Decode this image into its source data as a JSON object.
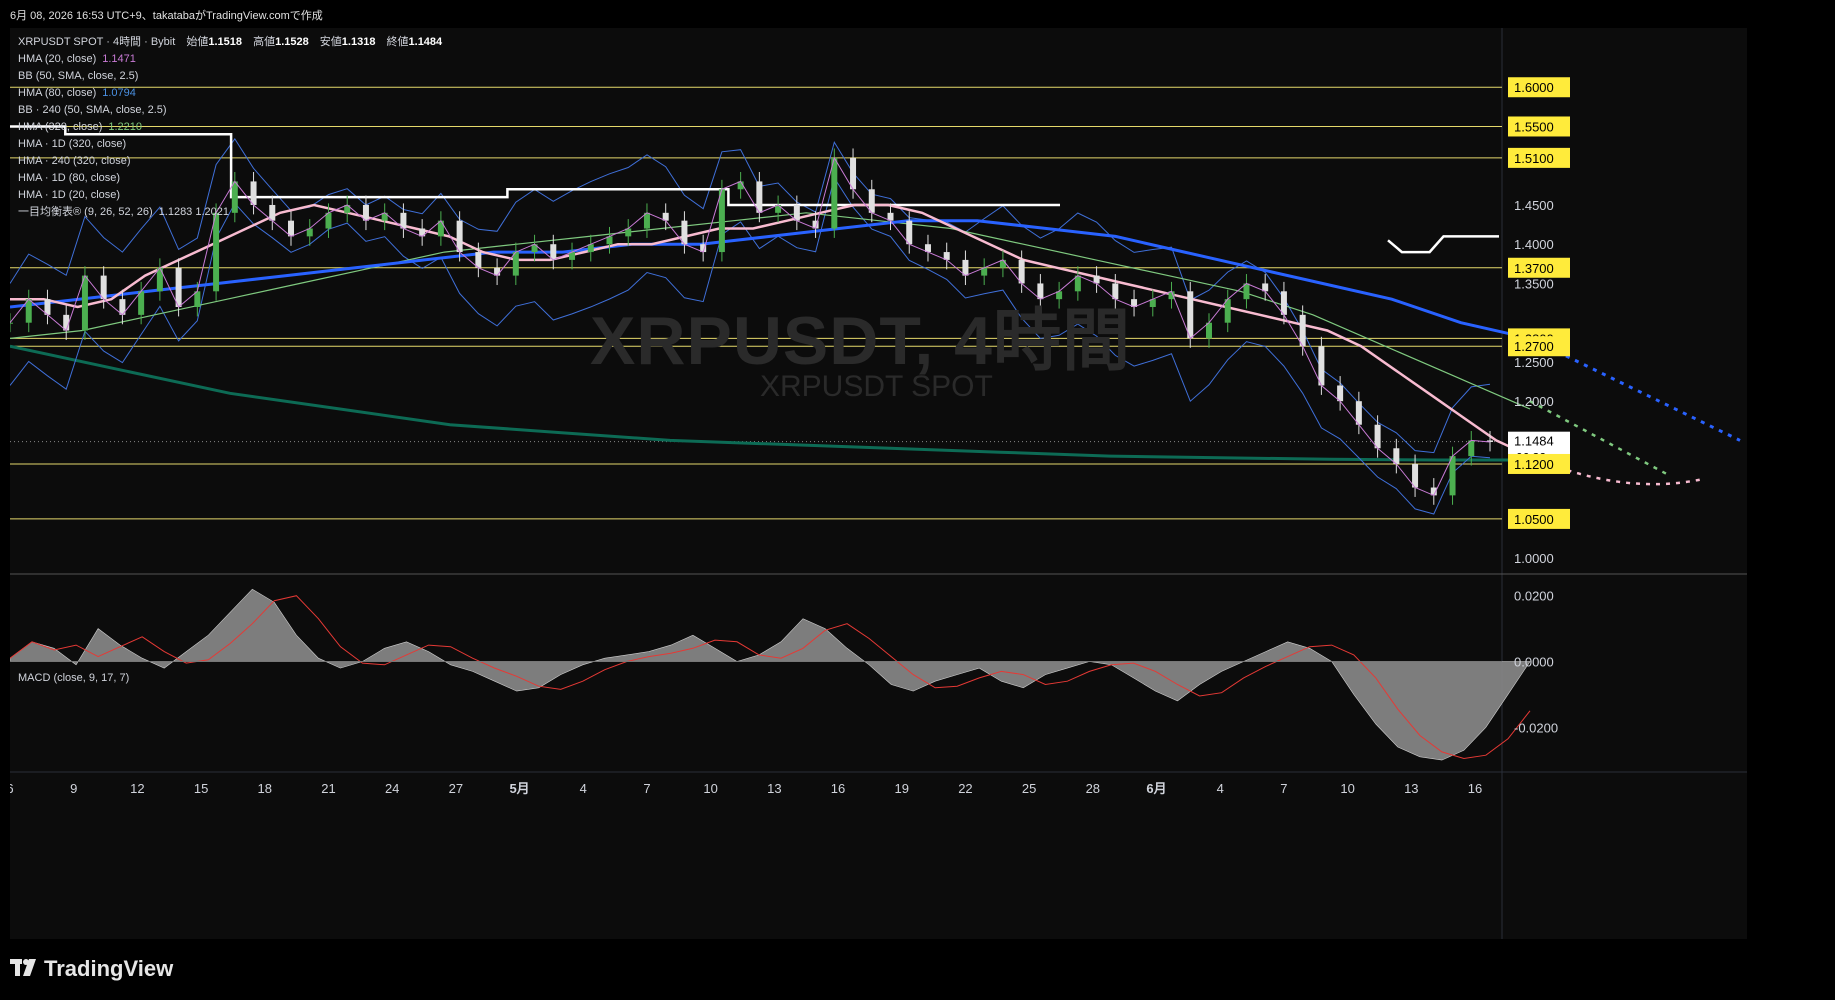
{
  "header": {
    "caption": "6月 08, 2026 16:53 UTC+9、takatabaがTradingView.comで作成"
  },
  "legend": {
    "symbol_line": "XRPUSDT SPOT · 4時間 · Bybit",
    "ohlc": [
      {
        "label": "始値",
        "value": "1.1518"
      },
      {
        "label": "高値",
        "value": "1.1528"
      },
      {
        "label": "安値",
        "value": "1.1318"
      },
      {
        "label": "終値",
        "value": "1.1484"
      }
    ],
    "indicators": [
      {
        "text": "HMA (20, close)",
        "value": "1.1471",
        "color": "#c97bd6"
      },
      {
        "text": "BB (50, SMA, close, 2.5)",
        "value": "",
        "color": "#d1d4dc"
      },
      {
        "text": "HMA (80, close)",
        "value": "1.0794",
        "color": "#4a90e2"
      },
      {
        "text": "BB · 240 (50, SMA, close, 2.5)",
        "value": "",
        "color": "#d1d4dc"
      },
      {
        "text": "HMA (320, close)",
        "value": "1.2210",
        "color": "#7fc97f"
      },
      {
        "text": "HMA · 1D (320, close)",
        "value": "",
        "color": "#d1d4dc"
      },
      {
        "text": "HMA · 240 (320, close)",
        "value": "",
        "color": "#d1d4dc"
      },
      {
        "text": "HMA · 1D (80, close)",
        "value": "",
        "color": "#d1d4dc"
      },
      {
        "text": "HMA · 1D (20, close)",
        "value": "",
        "color": "#d1d4dc"
      },
      {
        "text": "一目均衡表® (9, 26, 52, 26)",
        "value": "1.1283  1.2021",
        "color": "#d1d4dc"
      }
    ]
  },
  "watermark": {
    "main": "XRPUSDT, 4時間",
    "sub": "XRPUSDT SPOT"
  },
  "macd_label": "MACD (close, 9, 17, 7)",
  "footer": {
    "brand": "TradingView"
  },
  "colors": {
    "level_line": "#e5d96b",
    "level_badge_bg": "#ffeb3b",
    "candle_up": "#4caf50",
    "candle_down": "#e0e0e0",
    "hma20": "#c97bd6",
    "hma80": "#4a90e2",
    "hma320": "#7fc97f",
    "hma1d80": "#2962ff",
    "hma1d20": "#f8bbd0",
    "long_ma": "#0d6b55",
    "bb": "#3f6fd8",
    "step_line": "#ffffff",
    "price_badge": "#ffffff"
  },
  "chart_data": [
    {
      "type": "line",
      "title": "XRPUSDT SPOT · 4時間 · Bybit",
      "price_axis": {
        "range": [
          0.99,
          1.65
        ],
        "ticks": [
          "1.6000",
          "1.5500",
          "1.5100",
          "1.4500",
          "1.4000",
          "1.3700",
          "1.3500",
          "1.2800",
          "1.2700",
          "1.2500",
          "1.2000",
          "1.1484",
          "1.1200",
          "1.0500",
          "1.0000"
        ],
        "plain_ticks": [
          1.45,
          1.4,
          1.35,
          1.25,
          1.2,
          1.0
        ],
        "levels": [
          1.6,
          1.55,
          1.51,
          1.37,
          1.28,
          1.27,
          1.12,
          1.05
        ],
        "current_price": 1.1484,
        "countdown": "06:32"
      },
      "time_axis": {
        "labels": [
          "6",
          "9",
          "12",
          "15",
          "18",
          "21",
          "24",
          "27",
          "5月",
          "4",
          "7",
          "10",
          "13",
          "16",
          "19",
          "22",
          "25",
          "28",
          "6月",
          "4",
          "7",
          "10",
          "13",
          "16"
        ],
        "bold": [
          "5月",
          "6月"
        ]
      },
      "series": [
        {
          "key": "price",
          "values": [
            1.3,
            1.33,
            1.31,
            1.29,
            1.36,
            1.33,
            1.31,
            1.34,
            1.37,
            1.32,
            1.34,
            1.44,
            1.48,
            1.45,
            1.43,
            1.41,
            1.42,
            1.44,
            1.45,
            1.43,
            1.44,
            1.42,
            1.41,
            1.43,
            1.39,
            1.37,
            1.36,
            1.39,
            1.4,
            1.38,
            1.39,
            1.4,
            1.41,
            1.42,
            1.44,
            1.43,
            1.4,
            1.39,
            1.47,
            1.48,
            1.44,
            1.45,
            1.43,
            1.42,
            1.51,
            1.47,
            1.44,
            1.43,
            1.4,
            1.39,
            1.38,
            1.36,
            1.37,
            1.38,
            1.35,
            1.33,
            1.34,
            1.36,
            1.35,
            1.33,
            1.32,
            1.33,
            1.34,
            1.28,
            1.3,
            1.33,
            1.35,
            1.34,
            1.31,
            1.27,
            1.22,
            1.2,
            1.17,
            1.14,
            1.12,
            1.09,
            1.08,
            1.13,
            1.15,
            1.148
          ]
        },
        {
          "key": "hma1d20",
          "values": [
            1.33,
            1.33,
            1.32,
            1.33,
            1.36,
            1.38,
            1.4,
            1.42,
            1.44,
            1.45,
            1.44,
            1.43,
            1.42,
            1.41,
            1.39,
            1.38,
            1.38,
            1.39,
            1.4,
            1.4,
            1.41,
            1.42,
            1.42,
            1.43,
            1.44,
            1.45,
            1.45,
            1.44,
            1.42,
            1.4,
            1.38,
            1.37,
            1.36,
            1.35,
            1.34,
            1.33,
            1.32,
            1.31,
            1.3,
            1.29,
            1.27,
            1.24,
            1.21,
            1.18,
            1.15,
            1.13
          ]
        },
        {
          "key": "hma1d80",
          "values": [
            1.32,
            1.33,
            1.34,
            1.35,
            1.36,
            1.37,
            1.38,
            1.39,
            1.39,
            1.4,
            1.4,
            1.41,
            1.42,
            1.43,
            1.43,
            1.42,
            1.41,
            1.39,
            1.37,
            1.35,
            1.33,
            1.3,
            1.28
          ]
        },
        {
          "key": "hma320",
          "values": [
            1.28,
            1.29,
            1.31,
            1.33,
            1.35,
            1.37,
            1.39,
            1.4,
            1.41,
            1.42,
            1.43,
            1.44,
            1.43,
            1.42,
            1.4,
            1.38,
            1.36,
            1.34,
            1.31,
            1.27,
            1.23,
            1.19
          ]
        },
        {
          "key": "long_ma",
          "values": [
            1.27,
            1.24,
            1.21,
            1.19,
            1.17,
            1.16,
            1.15,
            1.145,
            1.14,
            1.135,
            1.13,
            1.128,
            1.126,
            1.125,
            1.125
          ]
        },
        {
          "key": "step",
          "values": [
            1.55,
            1.54,
            1.54,
            1.54,
            1.46,
            1.46,
            1.46,
            1.46,
            1.46,
            1.47,
            1.47,
            1.47,
            1.47,
            1.45,
            1.45,
            1.45,
            1.45,
            1.45,
            1.45,
            1.45
          ]
        },
        {
          "key": "step_future",
          "values": [
            1.405,
            1.39,
            1.39,
            1.39,
            1.41,
            1.41,
            1.41,
            1.41,
            1.41
          ]
        }
      ]
    },
    {
      "type": "area",
      "title": "MACD (close, 9, 17, 7)",
      "y_axis": {
        "range": [
          -0.033,
          0.026
        ],
        "ticks": [
          "0.0200",
          "0.0000",
          "-0.0200"
        ]
      },
      "series": [
        {
          "key": "macd",
          "values": [
            0.001,
            0.006,
            0.004,
            -0.001,
            0.01,
            0.005,
            0.001,
            -0.002,
            0.003,
            0.008,
            0.015,
            0.022,
            0.018,
            0.008,
            0.001,
            -0.002,
            0.0,
            0.004,
            0.006,
            0.003,
            -0.001,
            -0.003,
            -0.006,
            -0.009,
            -0.008,
            -0.004,
            -0.001,
            0.001,
            0.002,
            0.003,
            0.005,
            0.008,
            0.004,
            0.0,
            0.002,
            0.006,
            0.013,
            0.01,
            0.004,
            -0.001,
            -0.007,
            -0.009,
            -0.006,
            -0.004,
            -0.002,
            -0.006,
            -0.008,
            -0.004,
            -0.002,
            0.0,
            -0.001,
            -0.005,
            -0.009,
            -0.012,
            -0.007,
            -0.003,
            0.0,
            0.003,
            0.006,
            0.004,
            0.0,
            -0.01,
            -0.019,
            -0.026,
            -0.029,
            -0.03,
            -0.027,
            -0.02,
            -0.01,
            0.0
          ]
        }
      ]
    }
  ]
}
